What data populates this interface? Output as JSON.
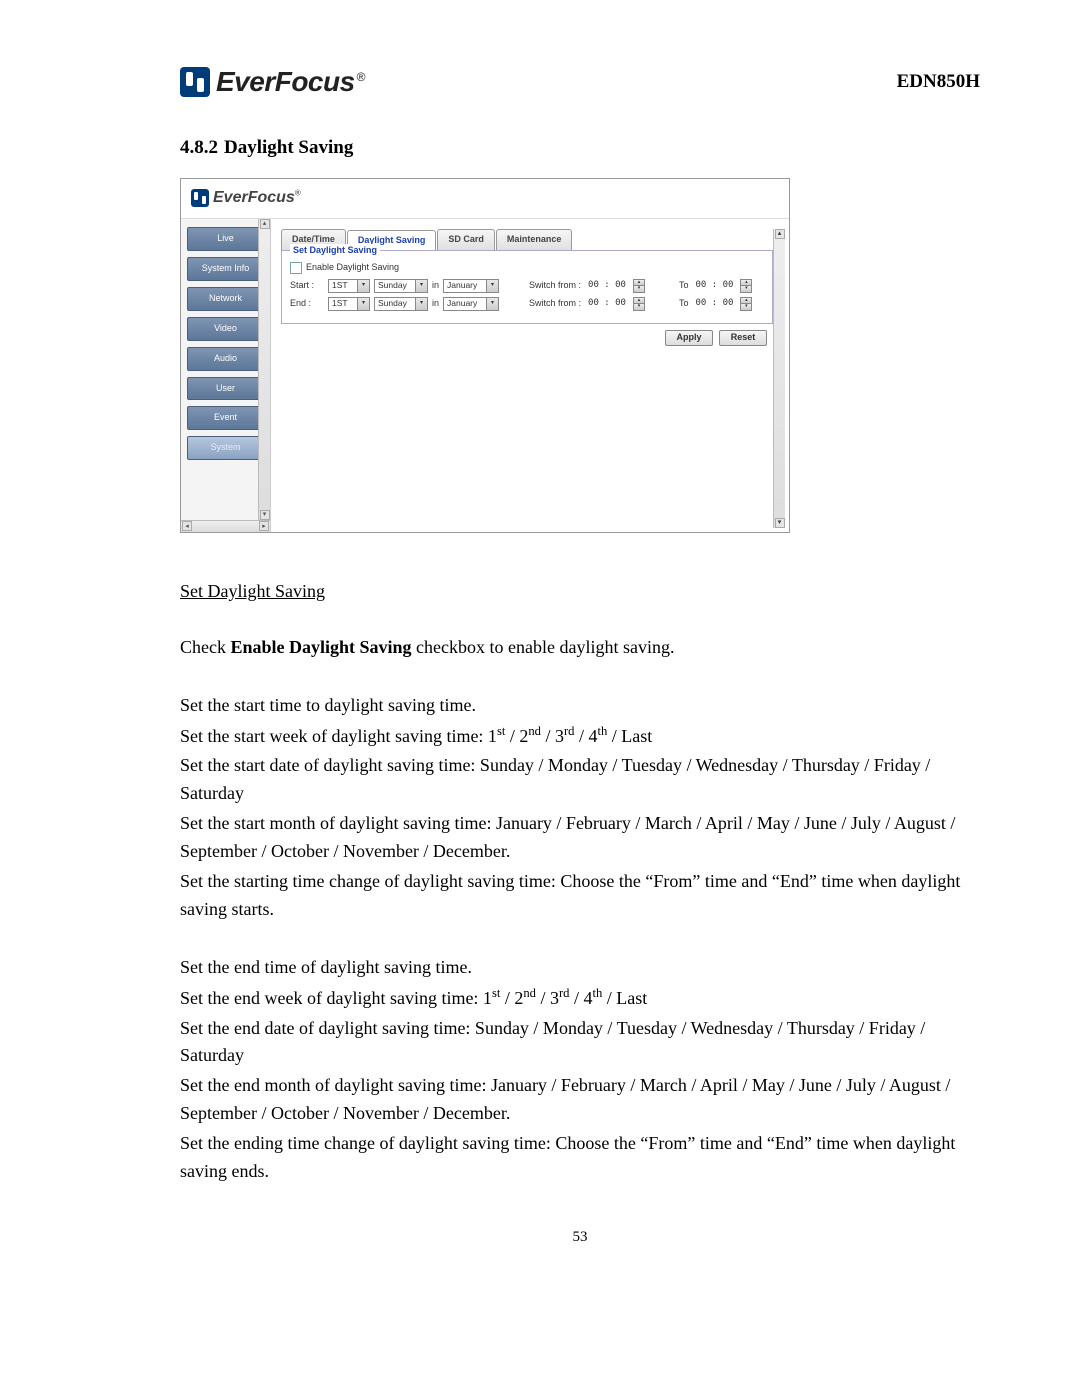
{
  "header": {
    "brand": "EverFocus",
    "model": "EDN850H"
  },
  "section": {
    "number": "4.8.2",
    "title": "Daylight Saving"
  },
  "ui": {
    "brand": "EverFocus",
    "nav": {
      "items": [
        {
          "label": "Live"
        },
        {
          "label": "System Info"
        },
        {
          "label": "Network"
        },
        {
          "label": "Video"
        },
        {
          "label": "Audio"
        },
        {
          "label": "User"
        },
        {
          "label": "Event"
        },
        {
          "label": "System"
        }
      ]
    },
    "tabs": [
      {
        "label": "Date/Time"
      },
      {
        "label": "Daylight Saving"
      },
      {
        "label": "SD Card"
      },
      {
        "label": "Maintenance"
      }
    ],
    "fieldset_legend": "Set Daylight Saving",
    "enable_label": "Enable Daylight Saving",
    "rows": {
      "start": {
        "label": "Start :",
        "week": "1ST",
        "day": "Sunday",
        "in": "in",
        "month": "January",
        "switch": "Switch from :",
        "from_time": "00 : 00",
        "to": "To",
        "to_time": "00 : 00"
      },
      "end": {
        "label": "End :",
        "week": "1ST",
        "day": "Sunday",
        "in": "in",
        "month": "January",
        "switch": "Switch from :",
        "from_time": "00 : 00",
        "to": "To",
        "to_time": "00 : 00"
      }
    },
    "buttons": {
      "apply": "Apply",
      "reset": "Reset"
    }
  },
  "text": {
    "subheader": "Set Daylight Saving",
    "check_line_pre": "Check ",
    "check_line_bold": "Enable Daylight Saving",
    "check_line_post": " checkbox to enable daylight saving.",
    "start_block": [
      "Set the start time to daylight saving time.",
      "Set the start week of daylight saving time: 1st / 2nd / 3rd / 4th / Last",
      "Set the start date of daylight saving time: Sunday / Monday / Tuesday / Wednesday / Thursday / Friday / Saturday",
      "Set the start month of daylight saving time: January / February / March / April / May / June / July / August / September / October / November / December.",
      "Set the starting time change of daylight saving time: Choose the “From” time and “End” time when daylight saving starts."
    ],
    "end_block": [
      "Set the end time of daylight saving time.",
      "Set the end week of daylight saving time: 1st / 2nd / 3rd / 4th / Last",
      "Set the end date of daylight saving time:  Sunday / Monday / Tuesday / Wednesday / Thursday / Friday / Saturday",
      "Set the end month of daylight saving time: January / February / March / April / May / June / July / August / September / October / November / December.",
      "Set the ending time change of daylight saving time: Choose the “From” time and “End” time when daylight saving ends."
    ]
  },
  "page_number": "53"
}
